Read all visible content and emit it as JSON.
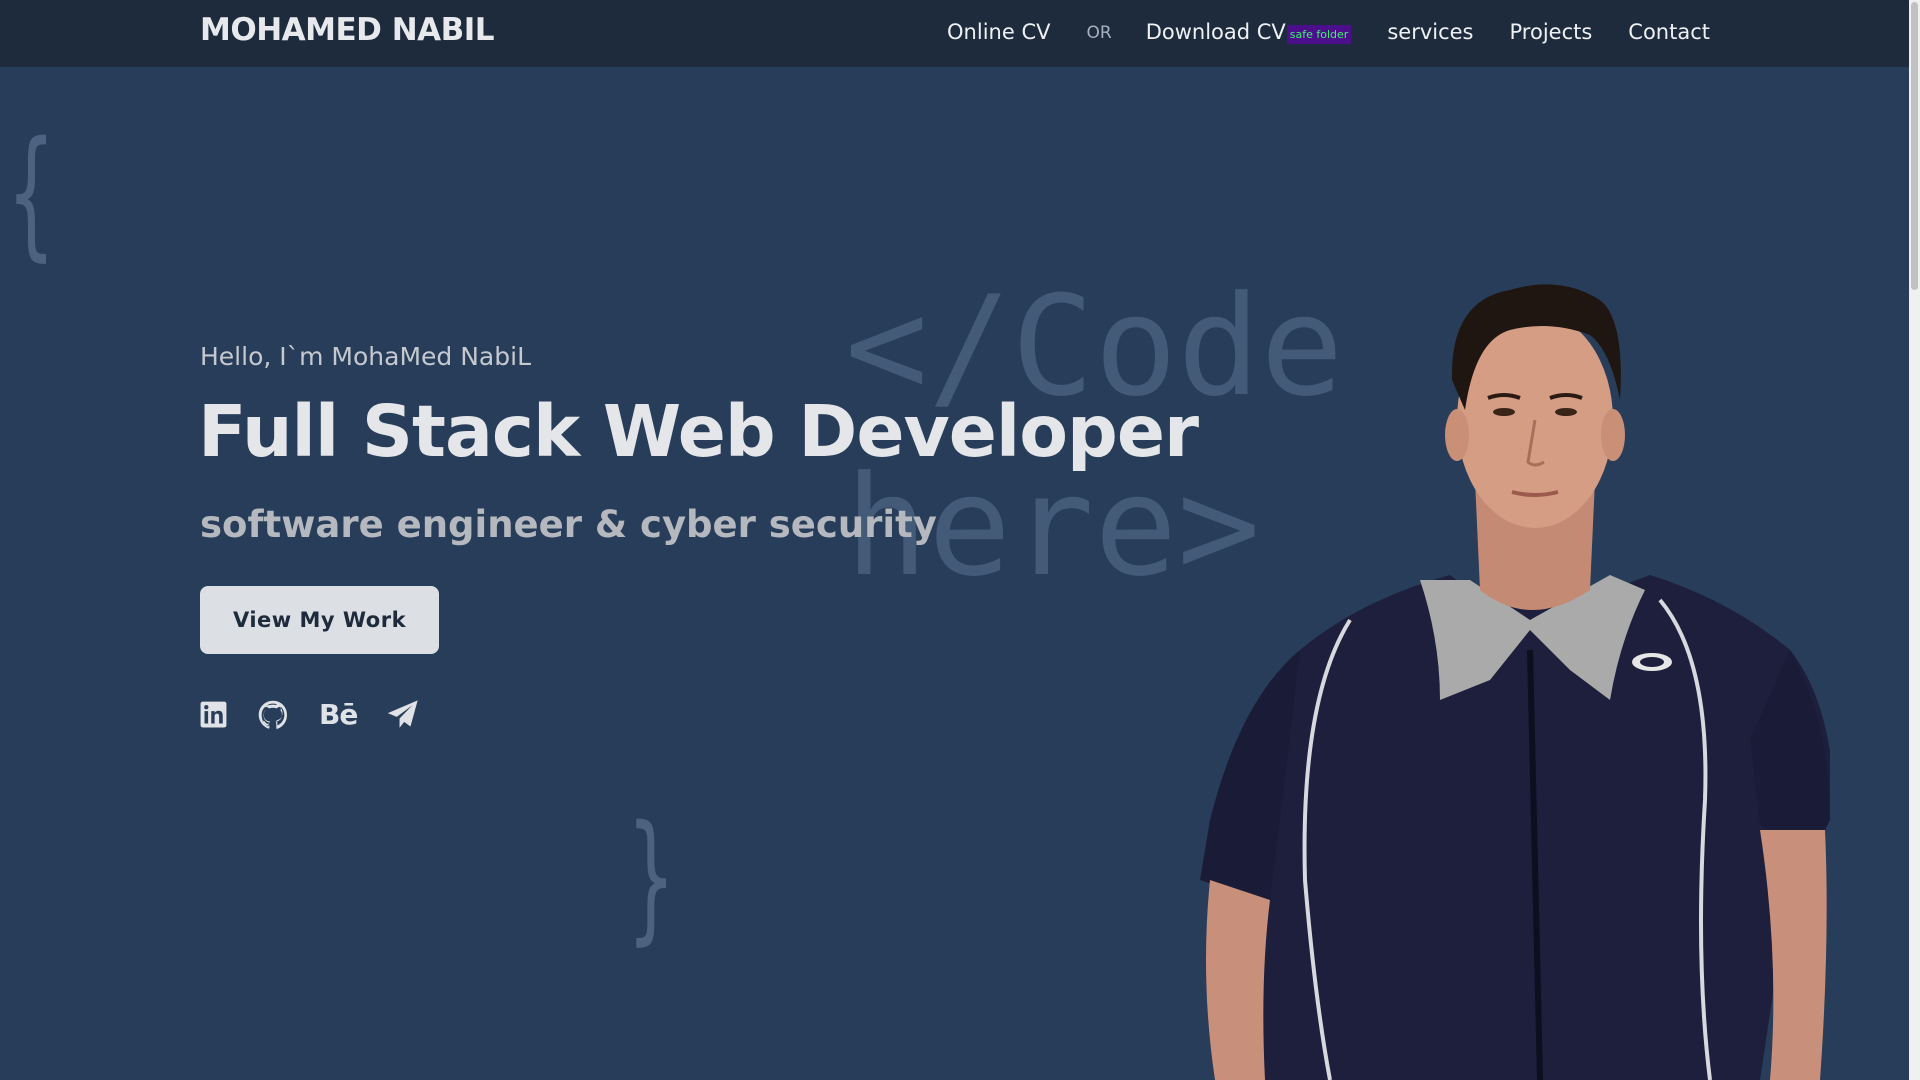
{
  "nav": {
    "brand": "MOHAMED NABIL",
    "online_cv": "Online CV",
    "or": "OR",
    "download_cv": "Download CV",
    "badge": "safe folder",
    "services": "services",
    "projects": "Projects",
    "contact": "Contact"
  },
  "hero": {
    "greeting": "Hello, I`m MohaMed NabiL",
    "headline": "Full Stack Web Developer",
    "subtitle": "software engineer & cyber security",
    "cta": "View My Work",
    "bg_code_line1": "</Code",
    "bg_code_line2": "here>",
    "brace_open": "{",
    "brace_close": "}"
  },
  "socials": [
    {
      "icon": "linkedin-icon"
    },
    {
      "icon": "github-icon"
    },
    {
      "icon": "behance-icon",
      "text": "Bē"
    },
    {
      "icon": "telegram-icon"
    }
  ],
  "colors": {
    "page_bg": "#283d59",
    "nav_bg": "#1e2b3c",
    "badge_bg": "#4b0f8c",
    "badge_text": "#3cf46c",
    "button_bg": "#dcdfe3"
  }
}
